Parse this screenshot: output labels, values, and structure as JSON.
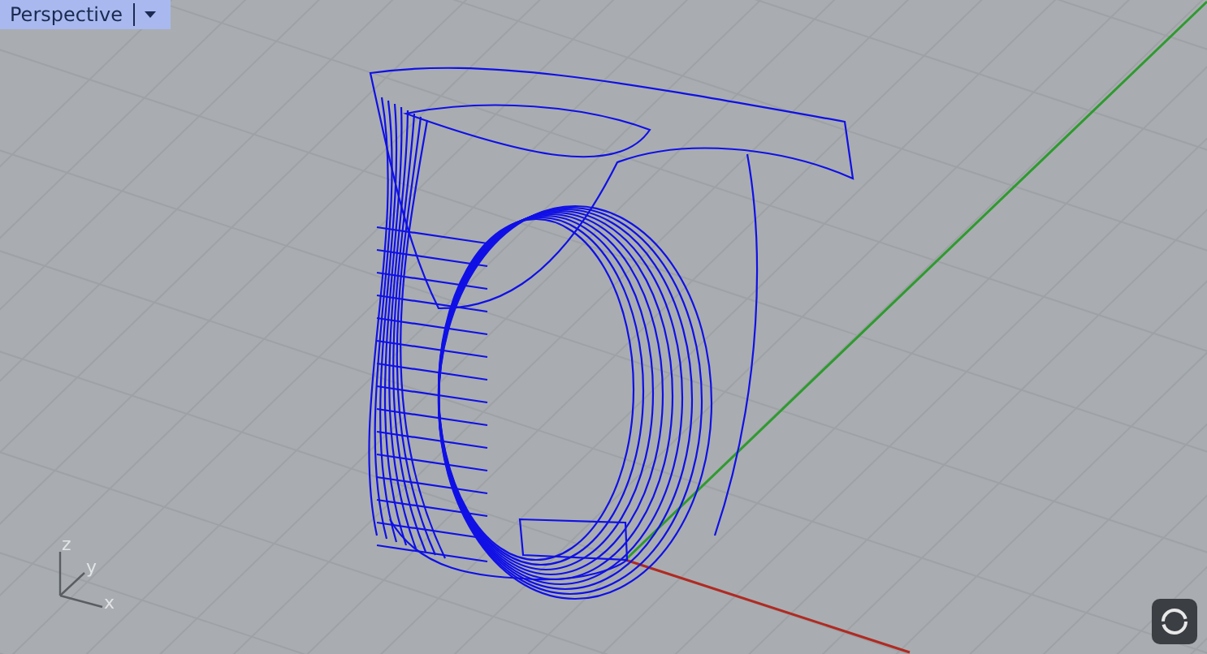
{
  "viewport": {
    "title": "Perspective",
    "axis_labels": [
      {
        "text": "z"
      },
      {
        "text": "y"
      },
      {
        "text": "x"
      }
    ]
  }
}
